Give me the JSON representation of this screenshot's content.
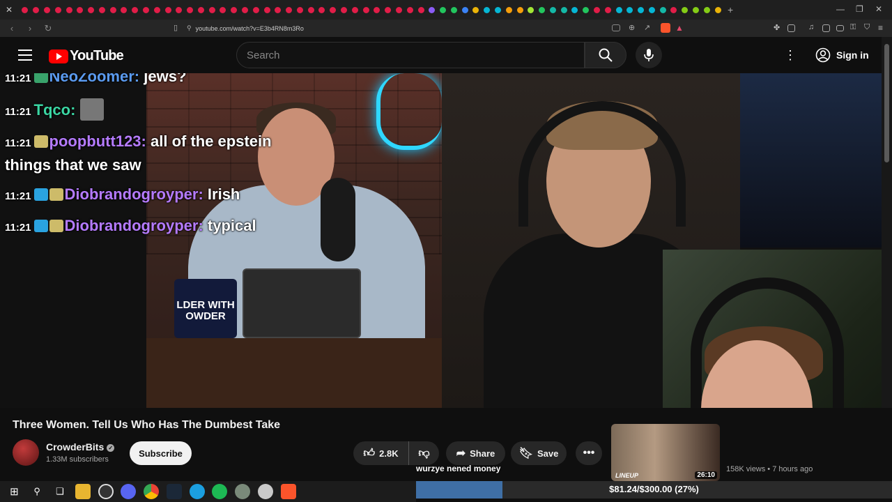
{
  "browser": {
    "url": "youtube.com/watch?v=E3b4RN8m3Ro",
    "tab_colors": [
      "#e11d48",
      "#e11d48",
      "#e11d48",
      "#e11d48",
      "#e11d48",
      "#e11d48",
      "#e11d48",
      "#e11d48",
      "#e11d48",
      "#e11d48",
      "#e11d48",
      "#e11d48",
      "#e11d48",
      "#e11d48",
      "#e11d48",
      "#e11d48",
      "#e11d48",
      "#e11d48",
      "#e11d48",
      "#e11d48",
      "#e11d48",
      "#e11d48",
      "#e11d48",
      "#e11d48",
      "#e11d48",
      "#e11d48",
      "#e11d48",
      "#e11d48",
      "#e11d48",
      "#e11d48",
      "#e11d48",
      "#e11d48",
      "#e11d48",
      "#e11d48",
      "#e11d48",
      "#e11d48",
      "#e11d48",
      "#8b5cf6",
      "#22c55e",
      "#22c55e",
      "#3b82f6",
      "#eab308",
      "#06b6d4",
      "#06b6d4",
      "#f59e0b",
      "#f59e0b",
      "#a3e635",
      "#22c55e",
      "#14b8a6",
      "#14b8a6",
      "#06b6d4",
      "#22c55e",
      "#e11d48",
      "#e11d48",
      "#06b6d4",
      "#06b6d4",
      "#06b6d4",
      "#06b6d4",
      "#14b8a6",
      "#e11d48",
      "#84cc16",
      "#84cc16",
      "#84cc16",
      "#eab308"
    ]
  },
  "youtube": {
    "logo_text": "YouTube",
    "search_placeholder": "Search",
    "sign_in": "Sign in"
  },
  "chat": [
    {
      "time": "11:21",
      "user": "NeoZoomer",
      "sep": ":",
      "text": "jews?",
      "user_color": "#5b9bf0",
      "badge": "#39a36b"
    },
    {
      "time": "11:21",
      "user": "Tqco",
      "sep": ":",
      "text": "",
      "user_color": "#3bd6a3",
      "badge": ""
    },
    {
      "time": "11:21",
      "user": "poopbutt123",
      "sep": ":",
      "text": "all of the epstein",
      "text2": "things that we saw",
      "user_color": "#b57bff",
      "badge": "#cdbb69"
    },
    {
      "time": "11:21",
      "user": "Diobrandogroyper",
      "sep": ":",
      "text": "Irish",
      "user_color": "#b57bff",
      "badge": "#2aa3e0"
    },
    {
      "time": "11:21",
      "user": "Diobrandogroyper",
      "sep": ":",
      "text": "typical",
      "user_color": "#b57bff",
      "badge": "#2aa3e0"
    }
  ],
  "video": {
    "title": "Three Women. Tell Us Who Has The Dumbest Take",
    "mug_text": "LDER WITH\nOWDER",
    "channel": "CrowderBits",
    "subscribers": "1.33M subscribers",
    "subscribe": "Subscribe",
    "likes": "2.8K",
    "share": "Share",
    "save": "Save"
  },
  "recommendation": {
    "thumb_label": "LINEUP",
    "duration": "26:10",
    "meta": "158K views • 7 hours ago"
  },
  "overlay": {
    "donation_text": "wurzye nened money",
    "goal_text": "$81.24/$300.00 (27%)",
    "goal_fraction": 0.27
  },
  "taskbar_icons": [
    "windows-icon",
    "search-icon",
    "task-view-icon",
    "file-explorer-icon",
    "obs-icon",
    "discord-icon",
    "chrome-icon",
    "steam-icon",
    "edge-icon",
    "spotify-icon",
    "app-icon",
    "app-icon-2",
    "brave-icon"
  ]
}
